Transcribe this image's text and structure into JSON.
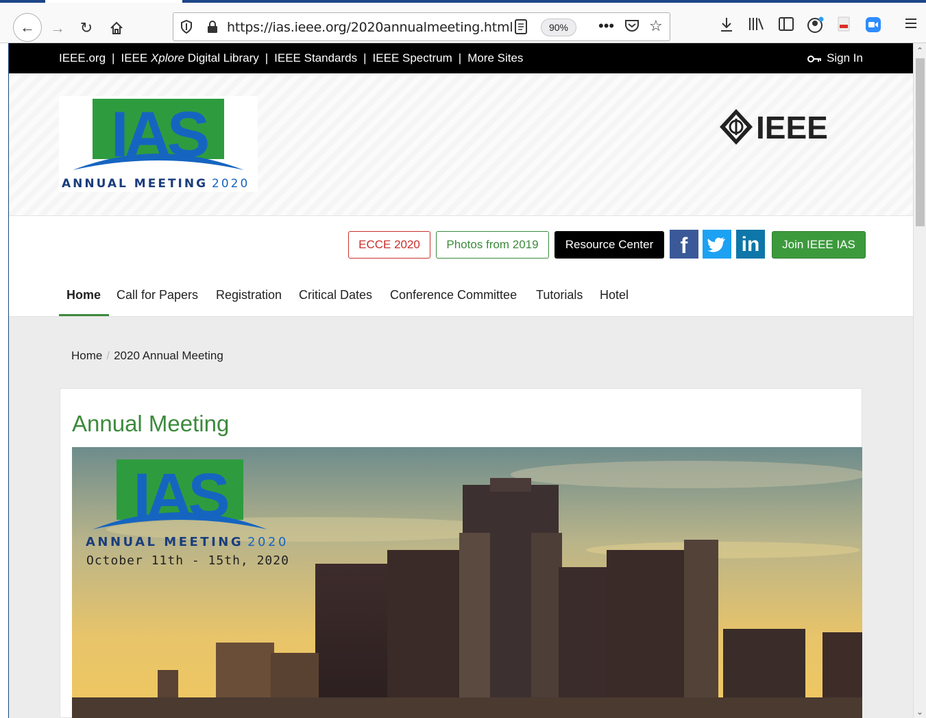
{
  "browser": {
    "url": "https://ias.ieee.org/2020annualmeeting.html",
    "zoom": "90%"
  },
  "meta_bar": {
    "links": [
      "IEEE.org",
      "IEEE ",
      "Xplore",
      " Digital Library",
      "IEEE Standards",
      "IEEE Spectrum",
      "More Sites"
    ],
    "sep": "|",
    "signin": "Sign In"
  },
  "logos": {
    "ias_text": "IAS",
    "ias_sub_a": "ANNUAL MEETING",
    "ias_sub_b": "2020",
    "ieee": "IEEE"
  },
  "buttons": {
    "ecce": "ECCE 2020",
    "photos": "Photos from 2019",
    "resource": "Resource Center",
    "facebook": "f",
    "linkedin": "in",
    "join": "Join IEEE IAS"
  },
  "nav": {
    "items": [
      "Home",
      "Call for Papers",
      "Registration",
      "Critical Dates",
      "Conference Committee",
      "Tutorials",
      "Hotel"
    ]
  },
  "breadcrumb": {
    "home": "Home",
    "sep": "/",
    "current": "2020 Annual Meeting"
  },
  "main": {
    "title": "Annual Meeting",
    "hero_date": "October 11th - 15th, 2020"
  },
  "colors": {
    "ias_green": "#2e9c3e",
    "ias_blue": "#1565c0",
    "accent_green": "#3c8a3c",
    "ecce_red": "#c9302c"
  }
}
